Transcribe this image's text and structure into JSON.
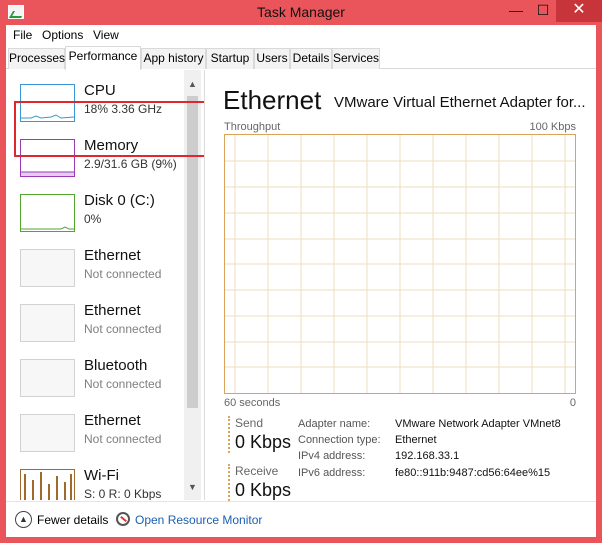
{
  "window": {
    "title": "Task Manager",
    "minimize": "—",
    "maximize": "☐",
    "close": "✕"
  },
  "menu": [
    "File",
    "Options",
    "View"
  ],
  "tabs": [
    "Processes",
    "Performance",
    "App history",
    "Startup",
    "Users",
    "Details",
    "Services"
  ],
  "active_tab": "Performance",
  "resources": [
    {
      "name": "CPU",
      "sub": "18%  3.36 GHz",
      "color": "#3a96d4",
      "selected": true
    },
    {
      "name": "Memory",
      "sub": "2.9/31.6 GB (9%)",
      "color": "#9b3ab4"
    },
    {
      "name": "Disk 0 (C:)",
      "sub": "0%",
      "color": "#52a52e"
    },
    {
      "name": "Ethernet",
      "sub": "Not connected"
    },
    {
      "name": "Ethernet",
      "sub": "Not connected"
    },
    {
      "name": "Bluetooth",
      "sub": "Not connected"
    },
    {
      "name": "Ethernet",
      "sub": "Not connected"
    },
    {
      "name": "Wi-Fi",
      "sub": "S: 0  R: 0 Kbps",
      "color": "#a06a2c"
    }
  ],
  "detail": {
    "title": "Ethernet",
    "adapter": "VMware Virtual Ethernet Adapter for...",
    "graph_label": "Throughput",
    "graph_max": "100 Kbps",
    "time_label": "60 seconds",
    "time_end": "0",
    "accent": "#d9a35c",
    "send_label": "Send",
    "send_value": "0 Kbps",
    "receive_label": "Receive",
    "receive_value": "0 Kbps",
    "info": [
      {
        "label": "Adapter name:",
        "value": "VMware Network Adapter VMnet8"
      },
      {
        "label": "Connection type:",
        "value": "Ethernet"
      },
      {
        "label": "IPv4 address:",
        "value": "192.168.33.1"
      },
      {
        "label": "IPv6 address:",
        "value": "fe80::911b:9487:cd56:64ee%15"
      }
    ]
  },
  "footer": {
    "fewer_details": "Fewer details",
    "resource_monitor": "Open Resource Monitor"
  }
}
